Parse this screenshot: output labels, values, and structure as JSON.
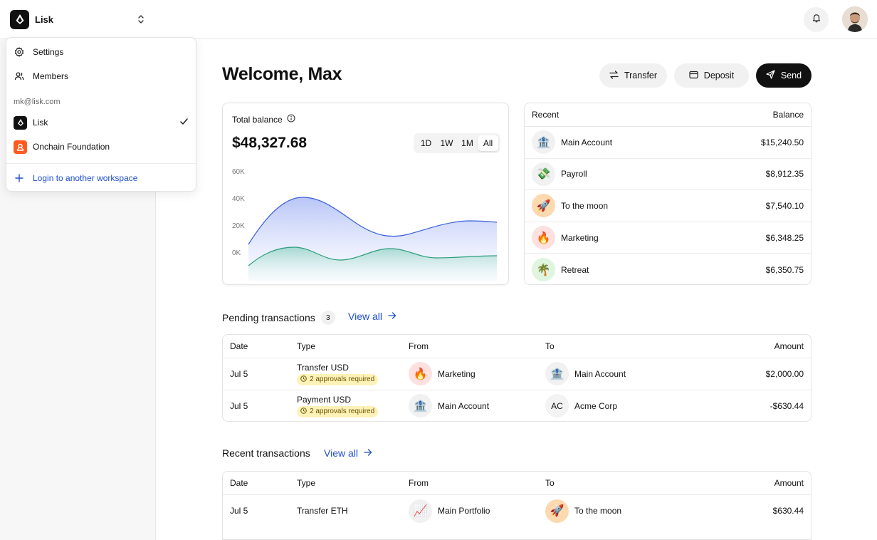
{
  "workspace": {
    "name": "Lisk",
    "menu": {
      "settings_label": "Settings",
      "members_label": "Members",
      "email": "mk@lisk.com",
      "workspaces": [
        {
          "name": "Lisk",
          "selected": true,
          "logo_color": "#111111"
        },
        {
          "name": "Onchain Foundation",
          "selected": false,
          "logo_color": "#ff5a1f"
        }
      ],
      "login_label": "Login to another workspace"
    }
  },
  "header": {
    "bell_icon": "bell-icon",
    "avatar_icon": "user-avatar"
  },
  "main": {
    "welcome": "Welcome, Max",
    "actions": {
      "transfer": "Transfer",
      "deposit": "Deposit",
      "send": "Send"
    }
  },
  "balance": {
    "label": "Total balance",
    "amount": "$48,327.68",
    "ranges": [
      "1D",
      "1W",
      "1M",
      "All"
    ],
    "active_range": "All",
    "yticks": [
      "60K",
      "40K",
      "20K",
      "0K"
    ]
  },
  "accounts": {
    "header_left": "Recent",
    "header_right": "Balance",
    "rows": [
      {
        "icon": "🏦",
        "bg": "#f1f1f1",
        "name": "Main Account",
        "balance": "$15,240.50"
      },
      {
        "icon": "💸",
        "bg": "#f1f1f1",
        "name": "Payroll",
        "balance": "$8,912.35"
      },
      {
        "icon": "🚀",
        "bg": "#fdd9b0",
        "name": "To the moon",
        "balance": "$7,540.10"
      },
      {
        "icon": "🔥",
        "bg": "#fde0e0",
        "name": "Marketing",
        "balance": "$6,348.25"
      },
      {
        "icon": "🌴",
        "bg": "#dff5e0",
        "name": "Retreat",
        "balance": "$6,350.75"
      }
    ]
  },
  "pending": {
    "title": "Pending transactions",
    "count": "3",
    "view_all": "View all",
    "columns": [
      "Date",
      "Type",
      "From",
      "To",
      "Amount"
    ],
    "rows": [
      {
        "date": "Jul 5",
        "type": "Transfer USD",
        "approval": "2 approvals required",
        "from_icon": "🔥",
        "from_bg": "#fde0e0",
        "from": "Marketing",
        "to_icon": "🏦",
        "to_bg": "#f1f1f1",
        "to": "Main Account",
        "amount": "$2,000.00"
      },
      {
        "date": "Jul 5",
        "type": "Payment USD",
        "approval": "2 approvals required",
        "from_icon": "🏦",
        "from_bg": "#f1f1f1",
        "from": "Main Account",
        "to_initials": "AC",
        "to": "Acme Corp",
        "amount": "-$630.44"
      }
    ]
  },
  "recent": {
    "title": "Recent transactions",
    "view_all": "View all",
    "columns": [
      "Date",
      "Type",
      "From",
      "To",
      "Amount"
    ],
    "rows": [
      {
        "date": "Jul 5",
        "type": "Transfer ETH",
        "from_icon": "📈",
        "from_bg": "#f1f1f1",
        "from": "Main Portfolio",
        "to_icon": "🚀",
        "to_bg": "#fdd9b0",
        "to": "To the moon",
        "amount": "$630.44"
      }
    ]
  },
  "colors": {
    "accent_blue": "#1f4fcf",
    "chart_blue": "#3b5fd9",
    "chart_green": "#2a9d7a",
    "approval_bg": "#fdf2b8"
  }
}
